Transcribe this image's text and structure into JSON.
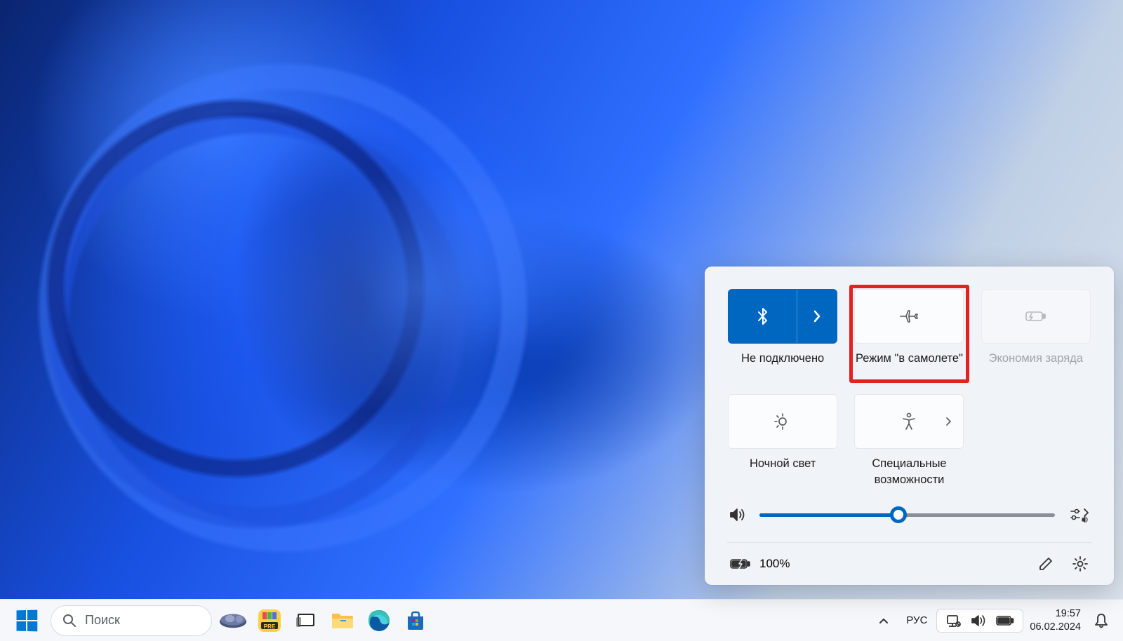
{
  "quick_settings": {
    "tiles": [
      {
        "id": "bluetooth",
        "label": "Не подключено"
      },
      {
        "id": "airplane",
        "label": "Режим \"в самолете\""
      },
      {
        "id": "battery-saver",
        "label": "Экономия заряда"
      },
      {
        "id": "night-light",
        "label": "Ночной свет"
      },
      {
        "id": "accessibility",
        "label": "Специальные возможности"
      }
    ],
    "volume_percent": 47,
    "battery_percent_text": "100%"
  },
  "taskbar": {
    "search_placeholder": "Поиск",
    "language": "РУС",
    "time": "19:57",
    "date": "06.02.2024",
    "pinned": [
      "canva",
      "pre",
      "task-view",
      "explorer",
      "edge",
      "store"
    ]
  }
}
